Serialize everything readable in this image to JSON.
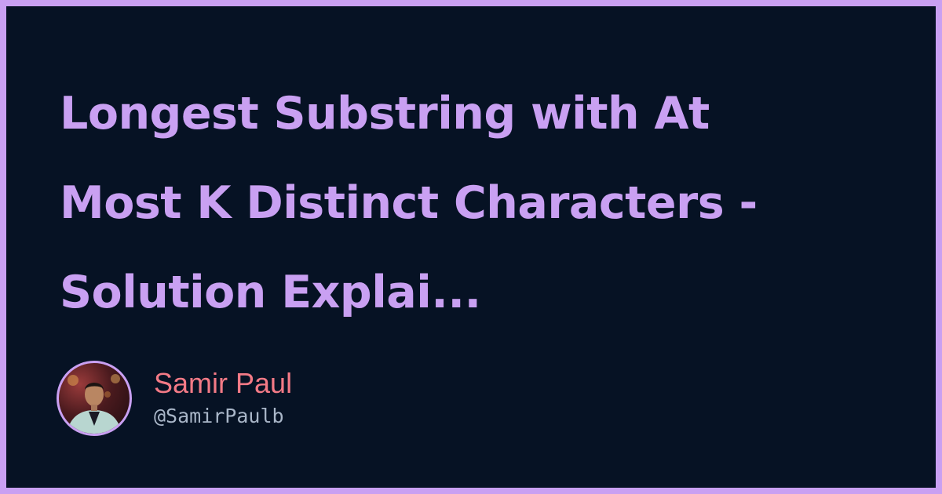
{
  "post": {
    "title": "Longest Substring with At\nMost K Distinct Characters -\nSolution Explai..."
  },
  "author": {
    "name": "Samir Paul",
    "handle": "@SamirPaulb",
    "avatar_icon": "profile-photo"
  },
  "colors": {
    "frame": "#C9A0F2",
    "background": "#061224",
    "title": "#C9A0F2",
    "author_name": "#F37A86",
    "author_handle": "#A9B6C8"
  }
}
